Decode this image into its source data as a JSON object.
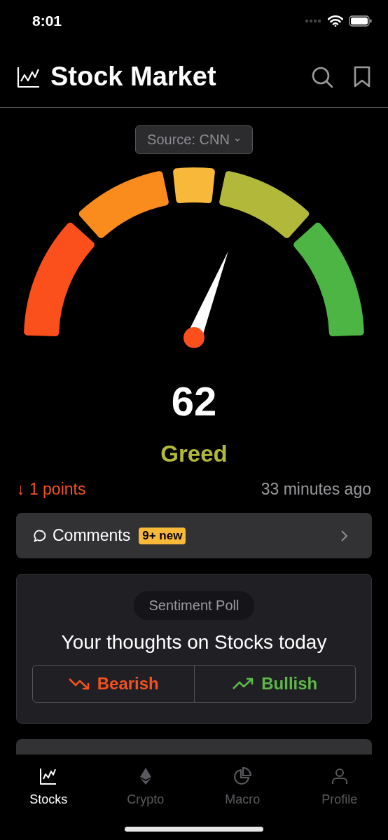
{
  "status_bar": {
    "time": "8:01"
  },
  "header": {
    "title": "Stock Market"
  },
  "source_dropdown": {
    "label": "Source: CNN"
  },
  "gauge": {
    "value": "62",
    "rating": "Greed"
  },
  "change": {
    "arrow": "↓",
    "text": "1 points"
  },
  "updated": "33 minutes ago",
  "comments": {
    "label": "Comments",
    "badge": "9+ new"
  },
  "poll": {
    "tag": "Sentiment Poll",
    "question": "Your thoughts on Stocks today",
    "options": [
      {
        "kind": "bearish",
        "label": "Bearish"
      },
      {
        "kind": "bullish",
        "label": "Bullish"
      }
    ]
  },
  "tabs": [
    {
      "kind": "stocks",
      "label": "Stocks",
      "selected": true
    },
    {
      "kind": "crypto",
      "label": "Crypto",
      "selected": false
    },
    {
      "kind": "macro",
      "label": "Macro",
      "selected": false
    },
    {
      "kind": "profile",
      "label": "Profile",
      "selected": false
    }
  ]
}
